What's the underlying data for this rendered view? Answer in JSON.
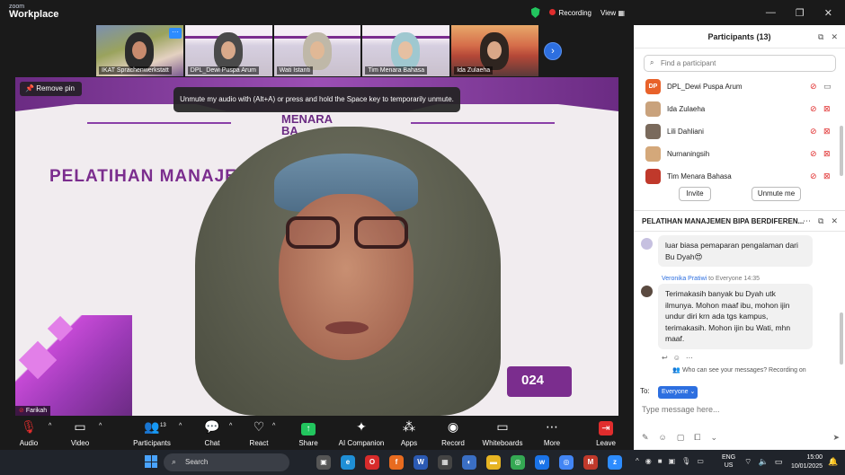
{
  "app": {
    "logo_line1": "zoom",
    "logo_line2": "Workplace",
    "recording_label": "Recording",
    "view_label": "View"
  },
  "window_controls": [
    "—",
    "❐",
    "✕"
  ],
  "thumbnails": [
    {
      "name": "IKAT Sprachenwerkstatt"
    },
    {
      "name": "DPL_Dewi Puspa Arum"
    },
    {
      "name": "Wati Istanti"
    },
    {
      "name": "Tim Menara Bahasa"
    },
    {
      "name": "Ida Zulaeha"
    }
  ],
  "main_video": {
    "remove_pin_label": "Remove pin",
    "unmute_tip": "Unmute my audio with (Alt+A) or press and hold the Space key to temporarily unmute.",
    "slide_logo_line1": "MENARA",
    "slide_logo_line2": "BA",
    "slide_title": "PELATIHAN MANAJEM          ERDIFERENSIASI",
    "slide_year": "024",
    "speaker_name": "Farikah"
  },
  "toolbar": {
    "audio": "Audio",
    "video": "Video",
    "participants": "Participants",
    "participants_count": "13",
    "chat": "Chat",
    "react": "React",
    "share": "Share",
    "ai_companion": "AI Companion",
    "apps": "Apps",
    "record": "Record",
    "whiteboards": "Whiteboards",
    "more": "More",
    "leave": "Leave"
  },
  "participants_panel": {
    "title": "Participants (13)",
    "search_placeholder": "Find a participant",
    "items": [
      {
        "initials": "DP",
        "name": "DPL_Dewi Puspa Arum",
        "avatar_color": "#e8622a",
        "cam": "on"
      },
      {
        "initials": "",
        "name": "Ida Zulaeha",
        "avatar_color": "#c9a27c",
        "cam": "off"
      },
      {
        "initials": "",
        "name": "Lili Dahliani",
        "avatar_color": "#7a6a5c",
        "cam": "off"
      },
      {
        "initials": "",
        "name": "Nurnaningsih",
        "avatar_color": "#d4a87a",
        "cam": "off"
      },
      {
        "initials": "",
        "name": "Tim Menara Bahasa",
        "avatar_color": "#c0392b",
        "cam": "off"
      }
    ],
    "invite_label": "Invite",
    "unmute_me_label": "Unmute me"
  },
  "chat_panel": {
    "title": "PELATIHAN MANAJEMEN BIPA BERDIFEREN...",
    "messages": [
      {
        "sender": "",
        "to": "",
        "time": "",
        "text": "luar biasa pemaparan pengalaman dari Bu Dyah😍"
      },
      {
        "sender": "Veronika Pratiwi",
        "to": "to Everyone",
        "time": "14:35",
        "text": "Terimakasih banyak bu Dyah utk ilmunya. Mohon maaf ibu, mohon ijin undur diri krn ada tgs kampus, terimakasih. Mohon ijin bu Wati, mhn maaf."
      }
    ],
    "who_can_see": "Who can see your messages? Recording on",
    "to_label": "To:",
    "to_value": "Everyone",
    "input_placeholder": "Type message here..."
  },
  "taskbar": {
    "search_label": "Search",
    "lang_line1": "ENG",
    "lang_line2": "US",
    "time": "15:00",
    "date": "10/01/2025"
  }
}
